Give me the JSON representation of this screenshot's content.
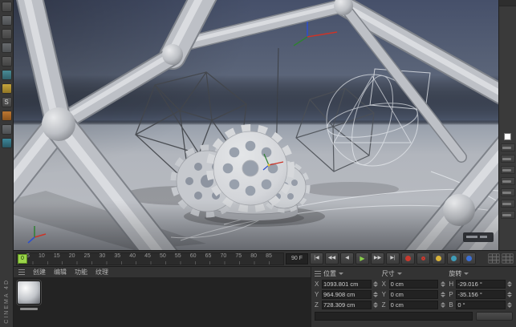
{
  "brand": {
    "vertical_text": "CINEMA 4D"
  },
  "left_toolbar": {
    "snap_label": "S"
  },
  "timeline": {
    "current_frame": "0",
    "end_frame": "90 F",
    "ticks": [
      "5",
      "10",
      "15",
      "20",
      "25",
      "30",
      "35",
      "40",
      "45",
      "50",
      "55",
      "60",
      "65",
      "70",
      "75",
      "80",
      "85"
    ],
    "transport": [
      "|◀",
      "◀◀",
      "◀",
      "▶",
      "▶▶",
      "▶|"
    ]
  },
  "material_panel": {
    "menu": [
      "创建",
      "编辑",
      "功能",
      "纹理"
    ]
  },
  "coordinates": {
    "position": {
      "title": "位置",
      "rows": [
        [
          "X",
          "1093.801 cm"
        ],
        [
          "Y",
          "964.908 cm"
        ],
        [
          "Z",
          "728.309 cm"
        ]
      ]
    },
    "size": {
      "title": "尺寸",
      "rows": [
        [
          "X",
          "0 cm"
        ],
        [
          "Y",
          "0 cm"
        ],
        [
          "Z",
          "0 cm"
        ]
      ]
    },
    "rotation": {
      "title": "旋转",
      "rows": [
        [
          "H",
          "-29.016 °"
        ],
        [
          "P",
          "-35.156 °"
        ],
        [
          "B",
          "0 °"
        ]
      ]
    }
  },
  "colors": {
    "timeline_green": "#9bd54a",
    "record_red": "#c8392e",
    "axis_red": "#cc3428",
    "axis_green": "#2f8032",
    "axis_blue": "#2b4fd0"
  }
}
